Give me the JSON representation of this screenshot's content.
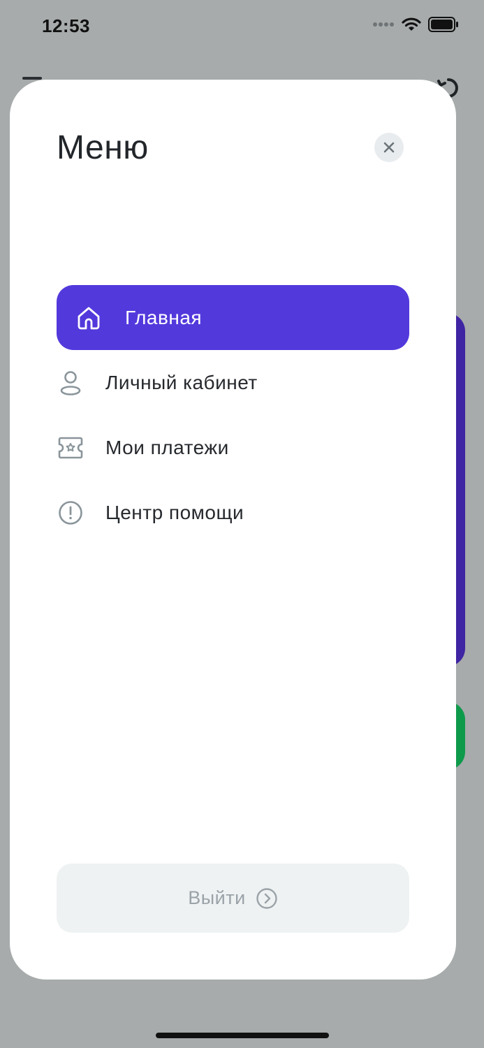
{
  "status_bar": {
    "time": "12:53"
  },
  "menu": {
    "title": "Меню",
    "items": [
      {
        "label": "Главная",
        "icon": "home-icon",
        "active": true
      },
      {
        "label": "Личный кабинет",
        "icon": "user-icon",
        "active": false
      },
      {
        "label": "Мои платежи",
        "icon": "ticket-star-icon",
        "active": false
      },
      {
        "label": "Центр помощи",
        "icon": "info-circle-icon",
        "active": false
      }
    ],
    "logout_label": "Выйти"
  },
  "colors": {
    "accent": "#5239dc",
    "background_dim": "#a7abab",
    "purple_card": "#3f24a3",
    "green_card": "#0e9a4b",
    "muted_text": "#9aa3a8"
  }
}
